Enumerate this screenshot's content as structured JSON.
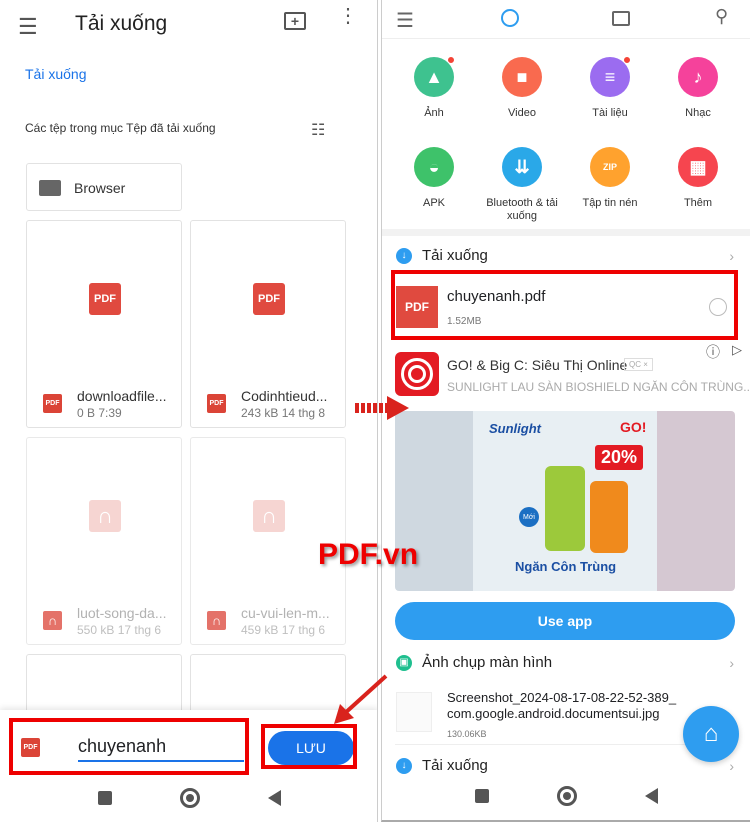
{
  "left": {
    "title": "Tải xuống",
    "breadcrumb": "Tải xuống",
    "section_label": "Các tệp trong mục Tệp đã tải xuống",
    "folder": "Browser",
    "files": [
      {
        "name": "downloadfile...",
        "meta": "0 B 7:39",
        "type": "pdf"
      },
      {
        "name": "Codinhtieud...",
        "meta": "243 kB 14 thg 8",
        "type": "pdf"
      },
      {
        "name": "luot-song-da...",
        "meta": "550 kB 17 thg 6",
        "type": "audio"
      },
      {
        "name": "cu-vui-len-m...",
        "meta": "459 kB 17 thg 6",
        "type": "audio"
      }
    ],
    "pdf_label": "PDF",
    "filename_value": "chuyenanh",
    "save_label": "LƯU"
  },
  "right": {
    "categories": [
      {
        "label": "Ảnh",
        "color": "#3ec28f",
        "icon": "image-icon",
        "badge": true
      },
      {
        "label": "Video",
        "color": "#f96a4f",
        "icon": "video-icon",
        "badge": false
      },
      {
        "label": "Tài liệu",
        "color": "#9b6cf0",
        "icon": "document-icon",
        "badge": true
      },
      {
        "label": "Nhạc",
        "color": "#f5429b",
        "icon": "music-icon",
        "badge": false
      },
      {
        "label": "APK",
        "color": "#3ec26a",
        "icon": "android-icon",
        "badge": false
      },
      {
        "label": "Bluetooth & tải xuống",
        "color": "#2aa8e8",
        "icon": "download-icon",
        "badge": false
      },
      {
        "label": "Tập tin nén",
        "color": "#ffa22e",
        "icon": "zip-icon",
        "badge": false
      },
      {
        "label": "Thêm",
        "color": "#f6454f",
        "icon": "grid-icon",
        "badge": false
      }
    ],
    "downloads_header": "Tải xuống",
    "recent_file": {
      "name": "chuyenanh.pdf",
      "size": "1.52MB",
      "badge": "PDF"
    },
    "ad": {
      "title": "GO! & Big C: Siêu Thị Online",
      "tag": "QC ×",
      "subtitle": "SUNLIGHT LAU SÀN BIOSHIELD NGĂN CÔN TRÙNG...",
      "brand": "Sunlight",
      "store": "GO!",
      "discount": "20%",
      "new": "Mới",
      "product": "Ngăn Côn Trùng",
      "button": "Use app"
    },
    "screenshots_header": "Ảnh chụp màn hình",
    "screenshot_file": {
      "name_line1": "Screenshot_2024-08-17-08-22-52-389_",
      "name_line2": "com.google.android.documentsui.jpg",
      "size": "130.06KB"
    },
    "downloads_header2": "Tải xuống"
  },
  "watermark": "PDF.vn",
  "colors": {
    "accent": "#1a73e8",
    "highlight": "#e00000",
    "fab": "#2e9df0"
  }
}
